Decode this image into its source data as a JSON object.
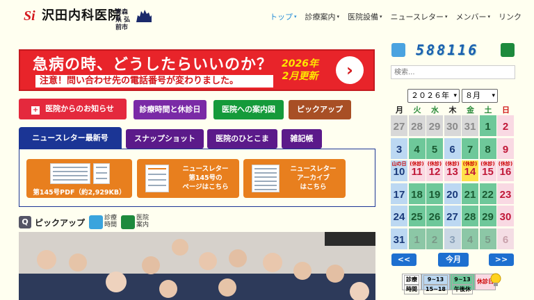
{
  "header": {
    "logo_mark": "Si",
    "logo_text": "沢田内科医院",
    "location": "青森県 弘前市",
    "nav": [
      {
        "label": "トップ",
        "active": true,
        "dropdown": true
      },
      {
        "label": "診療案内",
        "active": false,
        "dropdown": true
      },
      {
        "label": "医院設備",
        "active": false,
        "dropdown": true
      },
      {
        "label": "ニュースレター",
        "active": false,
        "dropdown": true
      },
      {
        "label": "メンバー",
        "active": false,
        "dropdown": true
      },
      {
        "label": "リンク",
        "active": false,
        "dropdown": false
      }
    ]
  },
  "banner": {
    "line1": "急病の時、どうしたらいいのか？",
    "line2": "注意！問い合わせ先の電話番号が変わりました。",
    "update": "2026年 2月更新",
    "update_l1": "2026年",
    "update_l2": "2月更新",
    "arrow": "›"
  },
  "tabs_row1": {
    "notice": "医院からのお知らせ",
    "notice_icon": "+",
    "hours": "診療時間と休診日",
    "access": "医院への案内図",
    "pickup": "ピックアップ"
  },
  "tabs_row2": {
    "news": "ニュースレター最新号",
    "snapshot": "スナップショット",
    "staff": "医院のひとこま",
    "misc": "雑記帳"
  },
  "newsletter": {
    "pdf": "第145号PDF（約2,929KB）",
    "page": [
      "ニュースレター",
      "第145号の",
      "ページはこちら"
    ],
    "archive": [
      "ニュースレター",
      "アーカイブ",
      "はこちら"
    ]
  },
  "pickup": {
    "title": "ピックアップ",
    "hours_label": [
      "診療",
      "時間"
    ],
    "info_label": [
      "医院",
      "案内"
    ]
  },
  "counter": "588116",
  "search": {
    "placeholder": "検索..."
  },
  "calendar": {
    "year": "２０２６年",
    "month": "８月",
    "weekdays": [
      "月",
      "火",
      "水",
      "木",
      "金",
      "土",
      "日"
    ],
    "weekday_colors": [
      "#222",
      "#2a8a3a",
      "#2a8a3a",
      "#222",
      "#2a8a3a",
      "#2a8a3a",
      "#d01818"
    ],
    "weeks": [
      [
        {
          "d": "27",
          "t": "o"
        },
        {
          "d": "28",
          "t": "o"
        },
        {
          "d": "29",
          "t": "o"
        },
        {
          "d": "30",
          "t": "o"
        },
        {
          "d": "31",
          "t": "o"
        },
        {
          "d": "1",
          "t": "g"
        },
        {
          "d": "2",
          "t": "s"
        }
      ],
      [
        {
          "d": "3",
          "t": "b"
        },
        {
          "d": "4",
          "t": "g"
        },
        {
          "d": "5",
          "t": "g"
        },
        {
          "d": "6",
          "t": "b"
        },
        {
          "d": "7",
          "t": "g"
        },
        {
          "d": "8",
          "t": "g"
        },
        {
          "d": "9",
          "t": "s"
        }
      ],
      [
        {
          "d": "10",
          "t": "b",
          "h": "山の日"
        },
        {
          "d": "11",
          "t": "h",
          "h": "(休診)"
        },
        {
          "d": "12",
          "t": "h",
          "h": "(休診)"
        },
        {
          "d": "13",
          "t": "h",
          "h": "(休診)"
        },
        {
          "d": "14",
          "t": "y",
          "h": "(休診)"
        },
        {
          "d": "15",
          "t": "h",
          "h": "(休診)"
        },
        {
          "d": "16",
          "t": "s",
          "h": "(休診)"
        }
      ],
      [
        {
          "d": "17",
          "t": "b"
        },
        {
          "d": "18",
          "t": "g"
        },
        {
          "d": "19",
          "t": "g"
        },
        {
          "d": "20",
          "t": "b"
        },
        {
          "d": "21",
          "t": "g"
        },
        {
          "d": "22",
          "t": "g"
        },
        {
          "d": "23",
          "t": "s"
        }
      ],
      [
        {
          "d": "24",
          "t": "b"
        },
        {
          "d": "25",
          "t": "g"
        },
        {
          "d": "26",
          "t": "g"
        },
        {
          "d": "27",
          "t": "b"
        },
        {
          "d": "28",
          "t": "g"
        },
        {
          "d": "29",
          "t": "g"
        },
        {
          "d": "30",
          "t": "s"
        }
      ],
      [
        {
          "d": "31",
          "t": "b"
        },
        {
          "d": "1",
          "t": "og"
        },
        {
          "d": "2",
          "t": "og"
        },
        {
          "d": "3",
          "t": "ob"
        },
        {
          "d": "4",
          "t": "og"
        },
        {
          "d": "5",
          "t": "og"
        },
        {
          "d": "6",
          "t": "os"
        }
      ]
    ],
    "prev": "<<",
    "today": "今月",
    "next": ">>"
  },
  "legend": {
    "label": [
      "診療",
      "時間"
    ],
    "am": [
      "9~13",
      "15~18"
    ],
    "pm": [
      "9~13",
      "午後休"
    ],
    "closed": "休診日"
  },
  "colors": {
    "accent": "#e8242a",
    "nav_active": "#2a8fd8",
    "newsletter": "#e87f1e",
    "calendar_blue": "#bcd8f2",
    "calendar_green": "#6ec89a",
    "calendar_pink": "#f9d9e3"
  }
}
